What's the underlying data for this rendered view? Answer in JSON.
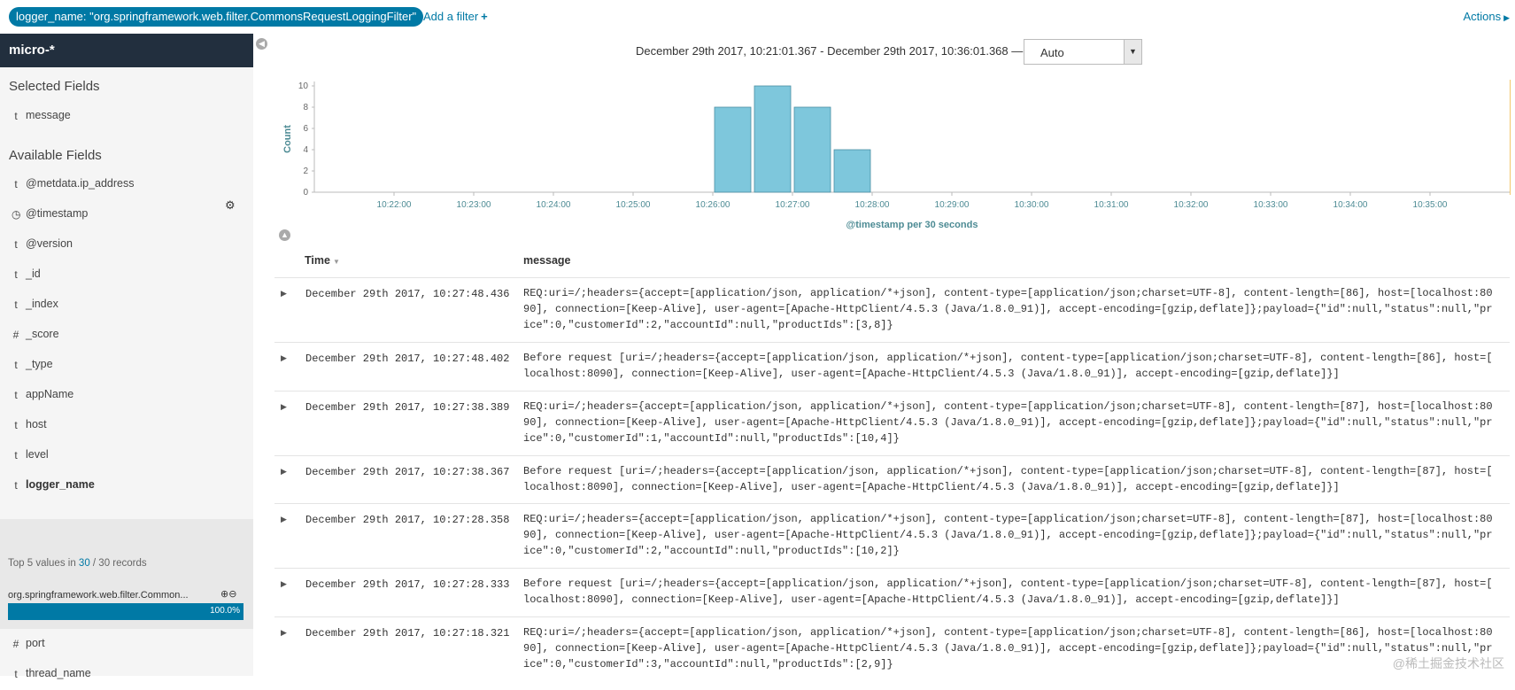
{
  "filter_bar": {
    "pill": "logger_name: \"org.springframework.web.filter.CommonsRequestLoggingFilter\"",
    "add_filter": "Add a filter",
    "add_filter_icon": "plus-icon",
    "actions": "Actions"
  },
  "sidebar": {
    "index_pattern": "micro-*",
    "selected_title": "Selected Fields",
    "selected_fields": [
      {
        "type": "t",
        "name": "message"
      }
    ],
    "available_title": "Available Fields",
    "settings_icon": "gear-icon",
    "available_fields": [
      {
        "type": "t",
        "name": "@metdata.ip_address"
      },
      {
        "type": "◷",
        "name": "@timestamp"
      },
      {
        "type": "t",
        "name": "@version"
      },
      {
        "type": "t",
        "name": "_id"
      },
      {
        "type": "t",
        "name": "_index"
      },
      {
        "type": "#",
        "name": "_score"
      },
      {
        "type": "t",
        "name": "_type"
      },
      {
        "type": "t",
        "name": "appName"
      },
      {
        "type": "t",
        "name": "host"
      },
      {
        "type": "t",
        "name": "level"
      },
      {
        "type": "t",
        "name": "logger_name"
      }
    ],
    "details": {
      "top5_prefix": "Top 5 values in ",
      "top5_count": "30",
      "top5_suffix": " / 30 records",
      "value": "org.springframework.web.filter.Common...",
      "percent_label": "100.0%",
      "percent": 1.0
    },
    "more_fields": [
      {
        "type": "#",
        "name": "port"
      },
      {
        "type": "t",
        "name": "thread_name"
      }
    ]
  },
  "main": {
    "date_range": "December 29th 2017, 10:21:01.367 - December 29th 2017, 10:36:01.368 —",
    "interval": "Auto"
  },
  "chart_data": {
    "type": "bar",
    "ylabel": "Count",
    "xlabel": "@timestamp per 30 seconds",
    "ylim": [
      0,
      10
    ],
    "yticks": [
      0,
      2,
      4,
      6,
      8,
      10
    ],
    "xlim_minutes": [
      21.0,
      36.0
    ],
    "xticks": [
      "10:22:00",
      "10:23:00",
      "10:24:00",
      "10:25:00",
      "10:26:00",
      "10:27:00",
      "10:28:00",
      "10:29:00",
      "10:30:00",
      "10:31:00",
      "10:32:00",
      "10:33:00",
      "10:34:00",
      "10:35:00"
    ],
    "bars": [
      {
        "start": "10:26:00",
        "value": 8
      },
      {
        "start": "10:26:30",
        "value": 10
      },
      {
        "start": "10:27:00",
        "value": 8
      },
      {
        "start": "10:27:30",
        "value": 4
      }
    ],
    "bar_color": "#7ec7dc"
  },
  "table": {
    "headers": {
      "time": "Time",
      "message": "message"
    },
    "rows": [
      {
        "time": "December 29th 2017, 10:27:48.436",
        "message": [
          "REQ:uri=/;headers={accept=[application/json, application/*+json], content-type=[application/json;charset=UTF-8], content-length=[86], host=[localhost:80",
          "90], connection=[Keep-Alive], user-agent=[Apache-HttpClient/4.5.3 (Java/1.8.0_91)], accept-encoding=[gzip,deflate]};payload={\"id\":null,\"status\":null,\"pr",
          "ice\":0,\"customerId\":2,\"accountId\":null,\"productIds\":[3,8]}"
        ]
      },
      {
        "time": "December 29th 2017, 10:27:48.402",
        "message": [
          "Before request [uri=/;headers={accept=[application/json, application/*+json], content-type=[application/json;charset=UTF-8], content-length=[86], host=[",
          "localhost:8090], connection=[Keep-Alive], user-agent=[Apache-HttpClient/4.5.3 (Java/1.8.0_91)], accept-encoding=[gzip,deflate]}]"
        ]
      },
      {
        "time": "December 29th 2017, 10:27:38.389",
        "message": [
          "REQ:uri=/;headers={accept=[application/json, application/*+json], content-type=[application/json;charset=UTF-8], content-length=[87], host=[localhost:80",
          "90], connection=[Keep-Alive], user-agent=[Apache-HttpClient/4.5.3 (Java/1.8.0_91)], accept-encoding=[gzip,deflate]};payload={\"id\":null,\"status\":null,\"pr",
          "ice\":0,\"customerId\":1,\"accountId\":null,\"productIds\":[10,4]}"
        ]
      },
      {
        "time": "December 29th 2017, 10:27:38.367",
        "message": [
          "Before request [uri=/;headers={accept=[application/json, application/*+json], content-type=[application/json;charset=UTF-8], content-length=[87], host=[",
          "localhost:8090], connection=[Keep-Alive], user-agent=[Apache-HttpClient/4.5.3 (Java/1.8.0_91)], accept-encoding=[gzip,deflate]}]"
        ]
      },
      {
        "time": "December 29th 2017, 10:27:28.358",
        "message": [
          "REQ:uri=/;headers={accept=[application/json, application/*+json], content-type=[application/json;charset=UTF-8], content-length=[87], host=[localhost:80",
          "90], connection=[Keep-Alive], user-agent=[Apache-HttpClient/4.5.3 (Java/1.8.0_91)], accept-encoding=[gzip,deflate]};payload={\"id\":null,\"status\":null,\"pr",
          "ice\":0,\"customerId\":2,\"accountId\":null,\"productIds\":[10,2]}"
        ]
      },
      {
        "time": "December 29th 2017, 10:27:28.333",
        "message": [
          "Before request [uri=/;headers={accept=[application/json, application/*+json], content-type=[application/json;charset=UTF-8], content-length=[87], host=[",
          "localhost:8090], connection=[Keep-Alive], user-agent=[Apache-HttpClient/4.5.3 (Java/1.8.0_91)], accept-encoding=[gzip,deflate]}]"
        ]
      },
      {
        "time": "December 29th 2017, 10:27:18.321",
        "message": [
          "REQ:uri=/;headers={accept=[application/json, application/*+json], content-type=[application/json;charset=UTF-8], content-length=[86], host=[localhost:80",
          "90], connection=[Keep-Alive], user-agent=[Apache-HttpClient/4.5.3 (Java/1.8.0_91)], accept-encoding=[gzip,deflate]};payload={\"id\":null,\"status\":null,\"pr",
          "ice\":0,\"customerId\":3,\"accountId\":null,\"productIds\":[2,9]}"
        ]
      }
    ]
  },
  "watermark": "@稀土掘金技术社区",
  "colors": {
    "accent": "#0079a5",
    "header_dark": "#222f3e",
    "bar": "#7ec7dc"
  }
}
